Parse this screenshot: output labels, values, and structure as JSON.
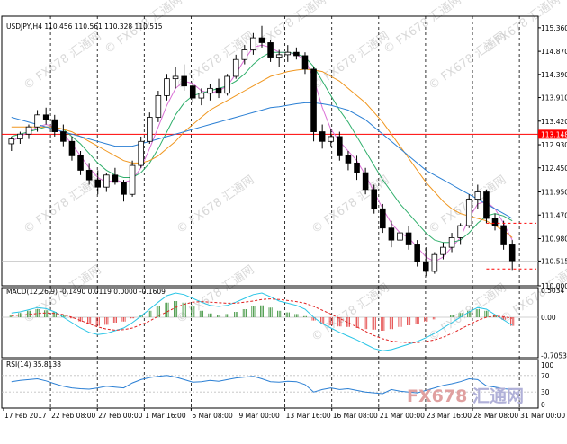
{
  "chart_data": {
    "type": "candlestick",
    "symbol_line": "USDJPY,H4  110.456 110.561 110.328 110.515",
    "x_tick_labels": [
      "17 Feb 2017",
      "22 Feb 08:00",
      "27 Feb 00:00",
      "1 Mar 16:00",
      "6 Mar 08:00",
      "9 Mar 00:00",
      "13 Mar 16:00",
      "16 Mar 08:00",
      "21 Mar 00:00",
      "23 Mar 16:00",
      "28 Mar 08:00",
      "31 Mar 00:00"
    ],
    "price_axis": {
      "ylim": [
        110.0,
        115.6
      ],
      "tick_labels": [
        "115.360",
        "114.870",
        "114.390",
        "113.910",
        "113.420",
        "112.930",
        "112.450",
        "111.950",
        "111.470",
        "110.980",
        "110.515",
        "110.000"
      ],
      "tick_values": [
        115.36,
        114.87,
        114.39,
        113.91,
        113.42,
        112.93,
        112.45,
        111.95,
        111.47,
        110.98,
        110.515,
        110.0
      ]
    },
    "horizontal_line": {
      "value": 113.148,
      "label": "113.148",
      "color": "#ff0000"
    },
    "current_price": {
      "value": 110.515,
      "label": "110.515"
    },
    "projection_lines": [
      111.3,
      110.35
    ],
    "candles": [
      [
        112.95,
        113.1,
        112.8,
        113.05
      ],
      [
        113.05,
        113.2,
        112.95,
        113.15
      ],
      [
        113.15,
        113.35,
        113.05,
        113.3
      ],
      [
        113.3,
        113.65,
        113.2,
        113.55
      ],
      [
        113.55,
        113.7,
        113.35,
        113.45
      ],
      [
        113.45,
        113.55,
        113.1,
        113.2
      ],
      [
        113.2,
        113.35,
        112.9,
        113.0
      ],
      [
        113.0,
        113.1,
        112.6,
        112.7
      ],
      [
        112.7,
        112.8,
        112.3,
        112.4
      ],
      [
        112.4,
        112.55,
        112.1,
        112.2
      ],
      [
        112.2,
        112.4,
        111.9,
        112.05
      ],
      [
        112.05,
        112.35,
        111.95,
        112.3
      ],
      [
        112.3,
        112.45,
        112.1,
        112.15
      ],
      [
        112.15,
        112.2,
        111.75,
        111.9
      ],
      [
        111.9,
        112.6,
        111.85,
        112.5
      ],
      [
        112.5,
        113.1,
        112.45,
        113.0
      ],
      [
        113.0,
        113.6,
        112.95,
        113.5
      ],
      [
        113.5,
        114.05,
        113.4,
        113.95
      ],
      [
        113.95,
        114.4,
        113.85,
        114.3
      ],
      [
        114.3,
        114.55,
        114.1,
        114.35
      ],
      [
        114.35,
        114.6,
        114.05,
        114.15
      ],
      [
        114.15,
        114.25,
        113.8,
        113.9
      ],
      [
        113.9,
        114.1,
        113.75,
        114.0
      ],
      [
        114.0,
        114.2,
        113.85,
        114.1
      ],
      [
        114.1,
        114.3,
        113.9,
        114.0
      ],
      [
        114.0,
        114.4,
        113.95,
        114.35
      ],
      [
        114.35,
        114.8,
        114.3,
        114.7
      ],
      [
        114.7,
        115.0,
        114.6,
        114.9
      ],
      [
        114.9,
        115.25,
        114.8,
        115.15
      ],
      [
        115.15,
        115.4,
        114.95,
        115.05
      ],
      [
        115.05,
        115.1,
        114.65,
        114.75
      ],
      [
        114.75,
        114.9,
        114.55,
        114.8
      ],
      [
        114.8,
        115.0,
        114.65,
        114.85
      ],
      [
        114.85,
        114.95,
        114.7,
        114.78
      ],
      [
        114.78,
        114.85,
        114.4,
        114.5
      ],
      [
        114.5,
        114.55,
        113.0,
        113.2
      ],
      [
        113.2,
        113.35,
        112.85,
        113.0
      ],
      [
        113.0,
        113.25,
        112.9,
        113.1
      ],
      [
        113.1,
        113.2,
        112.6,
        112.7
      ],
      [
        112.7,
        112.8,
        112.4,
        112.55
      ],
      [
        112.55,
        112.7,
        112.2,
        112.35
      ],
      [
        112.35,
        112.45,
        111.9,
        112.0
      ],
      [
        112.0,
        112.1,
        111.5,
        111.6
      ],
      [
        111.6,
        111.7,
        111.1,
        111.2
      ],
      [
        111.2,
        111.35,
        110.8,
        110.95
      ],
      [
        110.95,
        111.2,
        110.85,
        111.1
      ],
      [
        111.1,
        111.25,
        110.75,
        110.85
      ],
      [
        110.85,
        110.95,
        110.4,
        110.5
      ],
      [
        110.5,
        110.8,
        110.2,
        110.3
      ],
      [
        110.3,
        110.7,
        110.25,
        110.65
      ],
      [
        110.65,
        110.9,
        110.55,
        110.8
      ],
      [
        110.8,
        111.1,
        110.7,
        111.0
      ],
      [
        111.0,
        111.3,
        110.85,
        111.25
      ],
      [
        111.25,
        111.9,
        111.2,
        111.8
      ],
      [
        111.8,
        112.1,
        111.6,
        111.95
      ],
      [
        111.95,
        112.0,
        111.3,
        111.4
      ],
      [
        111.4,
        111.5,
        111.15,
        111.25
      ],
      [
        111.25,
        111.35,
        110.75,
        110.85
      ],
      [
        110.85,
        110.95,
        110.33,
        110.52
      ]
    ],
    "moving_averages": [
      {
        "color": "#da70d6",
        "values": [
          113.0,
          113.1,
          113.2,
          113.3,
          113.35,
          113.3,
          113.15,
          112.95,
          112.7,
          112.45,
          112.25,
          112.15,
          112.2,
          112.15,
          112.2,
          112.45,
          112.85,
          113.3,
          113.75,
          114.1,
          114.25,
          114.2,
          114.05,
          114.0,
          114.05,
          114.15,
          114.4,
          114.7,
          114.95,
          115.0,
          114.95,
          114.85,
          114.85,
          114.8,
          114.7,
          114.3,
          113.7,
          113.25,
          113.0,
          112.8,
          112.6,
          112.3,
          111.95,
          111.6,
          111.3,
          111.1,
          111.0,
          110.8,
          110.6,
          110.5,
          110.6,
          110.8,
          111.0,
          111.4,
          111.7,
          111.75,
          111.6,
          111.3,
          110.95
        ]
      },
      {
        "color": "#2eae6a",
        "values": [
          113.1,
          113.15,
          113.2,
          113.25,
          113.3,
          113.3,
          113.25,
          113.1,
          112.95,
          112.75,
          112.55,
          112.4,
          112.3,
          112.25,
          112.25,
          112.35,
          112.55,
          112.85,
          113.2,
          113.55,
          113.8,
          113.95,
          114.0,
          114.05,
          114.1,
          114.15,
          114.25,
          114.4,
          114.6,
          114.75,
          114.85,
          114.85,
          114.85,
          114.82,
          114.75,
          114.55,
          114.25,
          113.95,
          113.65,
          113.4,
          113.1,
          112.8,
          112.5,
          112.2,
          111.95,
          111.7,
          111.5,
          111.3,
          111.1,
          110.95,
          110.9,
          110.9,
          110.95,
          111.1,
          111.3,
          111.45,
          111.5,
          111.45,
          111.35
        ]
      },
      {
        "color": "#f0961e",
        "values": [
          113.3,
          113.3,
          113.3,
          113.3,
          113.3,
          113.3,
          113.25,
          113.2,
          113.1,
          113.0,
          112.9,
          112.8,
          112.7,
          112.6,
          112.55,
          112.55,
          112.6,
          112.7,
          112.85,
          113.0,
          113.2,
          113.35,
          113.5,
          113.65,
          113.75,
          113.85,
          113.95,
          114.05,
          114.15,
          114.25,
          114.35,
          114.4,
          114.45,
          114.48,
          114.5,
          114.48,
          114.45,
          114.35,
          114.25,
          114.1,
          113.95,
          113.8,
          113.6,
          113.4,
          113.15,
          112.9,
          112.65,
          112.4,
          112.15,
          111.95,
          111.75,
          111.6,
          111.5,
          111.45,
          111.4,
          111.35,
          111.25,
          111.15,
          111.0
        ]
      },
      {
        "color": "#2a7fd4",
        "values": [
          113.5,
          113.45,
          113.4,
          113.35,
          113.3,
          113.25,
          113.2,
          113.15,
          113.1,
          113.05,
          113.0,
          112.95,
          112.9,
          112.9,
          112.9,
          112.95,
          113.0,
          113.05,
          113.1,
          113.15,
          113.2,
          113.25,
          113.3,
          113.35,
          113.4,
          113.45,
          113.5,
          113.55,
          113.6,
          113.65,
          113.7,
          113.72,
          113.75,
          113.78,
          113.8,
          113.8,
          113.78,
          113.75,
          113.7,
          113.65,
          113.55,
          113.45,
          113.3,
          113.15,
          113.0,
          112.85,
          112.7,
          112.55,
          112.4,
          112.3,
          112.2,
          112.1,
          112.0,
          111.9,
          111.8,
          111.7,
          111.6,
          111.5,
          111.4
        ]
      }
    ],
    "macd": {
      "label": "MACD(12,26,9) -0.1490 0.0119 0.0000 -0.1609",
      "ylim": [
        -0.75,
        0.55
      ],
      "tick_labels": [
        "0.5034",
        "0.00",
        "-0.7053"
      ],
      "tick_values": [
        0.5034,
        0.0,
        -0.7053
      ],
      "histogram": [
        0.05,
        0.08,
        0.12,
        0.15,
        0.13,
        0.1,
        0.04,
        -0.02,
        -0.08,
        -0.13,
        -0.16,
        -0.14,
        -0.1,
        -0.08,
        -0.02,
        0.05,
        0.12,
        0.2,
        0.27,
        0.3,
        0.27,
        0.2,
        0.12,
        0.07,
        0.04,
        0.06,
        0.1,
        0.15,
        0.2,
        0.22,
        0.18,
        0.12,
        0.09,
        0.06,
        0.02,
        -0.06,
        -0.12,
        -0.15,
        -0.17,
        -0.18,
        -0.2,
        -0.22,
        -0.23,
        -0.25,
        -0.22,
        -0.18,
        -0.15,
        -0.12,
        -0.08,
        -0.04,
        0.0,
        0.04,
        0.08,
        0.12,
        0.15,
        0.12,
        0.05,
        -0.05,
        -0.16
      ],
      "macd_line": [
        0.08,
        0.1,
        0.14,
        0.18,
        0.16,
        0.1,
        0.0,
        -0.1,
        -0.2,
        -0.28,
        -0.32,
        -0.3,
        -0.25,
        -0.2,
        -0.1,
        0.02,
        0.15,
        0.28,
        0.4,
        0.45,
        0.42,
        0.35,
        0.28,
        0.22,
        0.2,
        0.22,
        0.28,
        0.35,
        0.42,
        0.45,
        0.38,
        0.3,
        0.26,
        0.22,
        0.15,
        0.0,
        -0.12,
        -0.2,
        -0.28,
        -0.35,
        -0.42,
        -0.5,
        -0.58,
        -0.62,
        -0.6,
        -0.55,
        -0.5,
        -0.45,
        -0.38,
        -0.3,
        -0.2,
        -0.1,
        0.0,
        0.1,
        0.18,
        0.15,
        0.05,
        -0.05,
        -0.15
      ],
      "signal_line": [
        0.03,
        0.04,
        0.05,
        0.07,
        0.08,
        0.07,
        0.05,
        0.0,
        -0.06,
        -0.12,
        -0.18,
        -0.22,
        -0.24,
        -0.23,
        -0.2,
        -0.14,
        -0.07,
        0.02,
        0.1,
        0.18,
        0.24,
        0.28,
        0.29,
        0.28,
        0.27,
        0.26,
        0.26,
        0.28,
        0.3,
        0.33,
        0.34,
        0.33,
        0.31,
        0.29,
        0.26,
        0.2,
        0.13,
        0.06,
        -0.02,
        -0.1,
        -0.18,
        -0.26,
        -0.34,
        -0.4,
        -0.44,
        -0.46,
        -0.47,
        -0.47,
        -0.45,
        -0.42,
        -0.37,
        -0.3,
        -0.22,
        -0.14,
        -0.06,
        0.0,
        0.02,
        0.01,
        -0.02
      ]
    },
    "rsi": {
      "label": "RSI(14) 35.8138",
      "ylim": [
        0,
        100
      ],
      "tick_labels": [
        "100",
        "70",
        "30",
        "0"
      ],
      "tick_values": [
        100,
        70,
        30,
        0
      ],
      "levels": [
        70,
        30
      ],
      "values": [
        55,
        58,
        60,
        62,
        57,
        50,
        44,
        40,
        38,
        37,
        40,
        44,
        42,
        40,
        52,
        60,
        65,
        68,
        70,
        66,
        60,
        54,
        55,
        58,
        56,
        60,
        64,
        66,
        68,
        62,
        55,
        54,
        56,
        55,
        48,
        30,
        36,
        40,
        36,
        38,
        34,
        30,
        28,
        26,
        36,
        32,
        30,
        28,
        34,
        40,
        46,
        50,
        55,
        62,
        60,
        45,
        42,
        38,
        36
      ]
    },
    "watermark": "FX678 汇通网",
    "logo_text": {
      "brand": "FX678",
      "cn": "汇通网"
    }
  },
  "colors": {
    "bull_body": "#ffffff",
    "bear_body": "#000000",
    "grid_vertical": "#000000",
    "zero_line": "#c0c0c0",
    "macd_pos": "#2e8b2e",
    "macd_neg": "#e03030",
    "macd_line": "#29c5e6",
    "signal_line": "#e02020",
    "rsi_line": "#2a7fd4",
    "price_tag_bg": "#ff0000",
    "projection": "#ff0000",
    "logo_brand": "#e0a0a0",
    "logo_cn": "#b0b0d8"
  }
}
